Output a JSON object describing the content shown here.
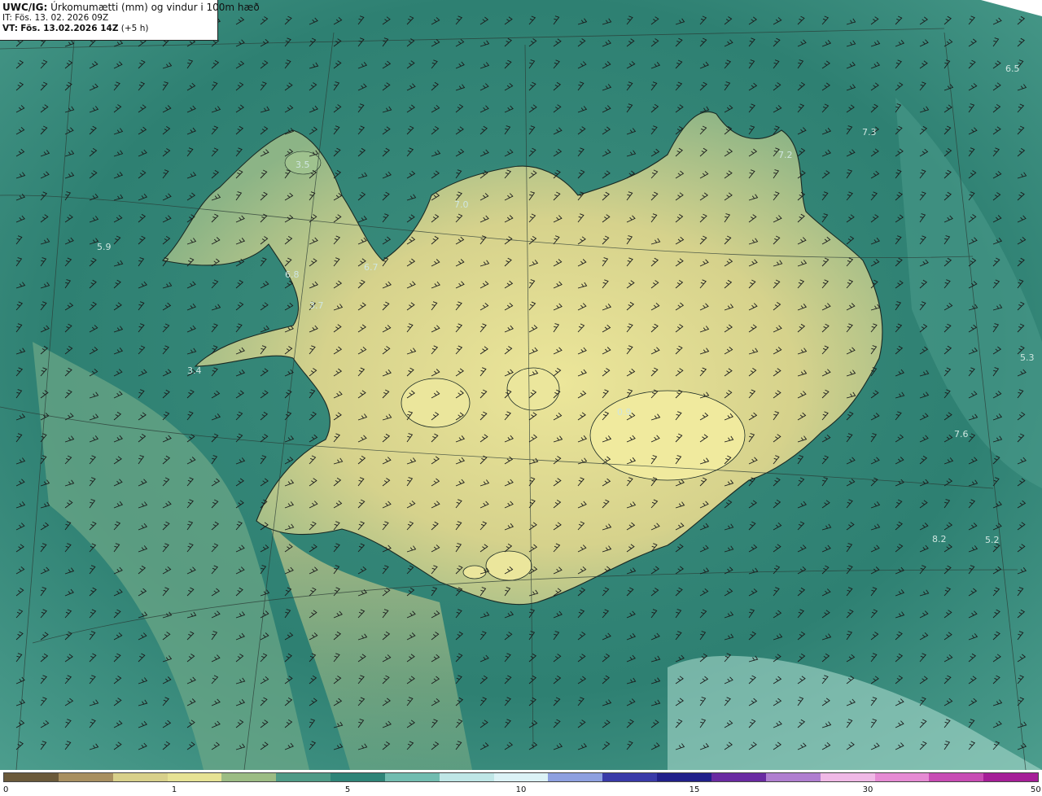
{
  "header": {
    "product": "UWC/IG:",
    "title": "Úrkomumætti (mm) og vindur i 100m hæð",
    "init_time": "IT: Fös. 13. 02. 2026 09Z",
    "valid_label": "VT:",
    "valid_time": "Fös. 13.02.2026 14Z",
    "lead": "(+5 h)"
  },
  "colorbar": {
    "ticks": [
      "0",
      "1",
      "5",
      "10",
      "15",
      "30",
      "50"
    ],
    "segments": [
      {
        "color": "#6b5a3a",
        "flex": 2
      },
      {
        "color": "#a89060",
        "flex": 2
      },
      {
        "color": "#d8d08a",
        "flex": 2
      },
      {
        "color": "#e6e294",
        "flex": 2
      },
      {
        "color": "#9cbc84",
        "flex": 2
      },
      {
        "color": "#4e9a86",
        "flex": 2
      },
      {
        "color": "#2f8478",
        "flex": 2
      },
      {
        "color": "#72bcb0",
        "flex": 2
      },
      {
        "color": "#bfe6e6",
        "flex": 2
      },
      {
        "color": "#dcf2f6",
        "flex": 2
      },
      {
        "color": "#8ea0e0",
        "flex": 2
      },
      {
        "color": "#3a3aa8",
        "flex": 2
      },
      {
        "color": "#22208a",
        "flex": 2
      },
      {
        "color": "#6a2aa2",
        "flex": 2
      },
      {
        "color": "#b07ed0",
        "flex": 2
      },
      {
        "color": "#f0b8e6",
        "flex": 2
      },
      {
        "color": "#e68ad4",
        "flex": 2
      },
      {
        "color": "#c84cb4",
        "flex": 2
      },
      {
        "color": "#a61e98",
        "flex": 2
      }
    ]
  },
  "map_labels": [
    {
      "id": "label-35",
      "text": "3.5"
    },
    {
      "id": "label-59",
      "text": "5.9"
    },
    {
      "id": "label-68",
      "text": "6.8"
    },
    {
      "id": "label-67",
      "text": "6.7"
    },
    {
      "id": "label-37",
      "text": "3.7"
    },
    {
      "id": "label-34",
      "text": "3.4"
    },
    {
      "id": "label-70",
      "text": "7.0"
    },
    {
      "id": "label-72",
      "text": "7.2"
    },
    {
      "id": "label-73",
      "text": "7.3"
    },
    {
      "id": "label-65",
      "text": "6.5"
    },
    {
      "id": "label-53",
      "text": "5.3"
    },
    {
      "id": "label-76",
      "text": "7.6"
    },
    {
      "id": "label-82",
      "text": "8.2"
    },
    {
      "id": "label-52",
      "text": "5.2"
    },
    {
      "id": "label-09",
      "text": "0.9"
    }
  ],
  "colors": {
    "sea": "#2f8476",
    "sea_light": "#5aa898",
    "land_low": "#7fae86",
    "land_high": "#e4df92",
    "coast": "#1a2a24",
    "barb": "#1a1a1a"
  }
}
